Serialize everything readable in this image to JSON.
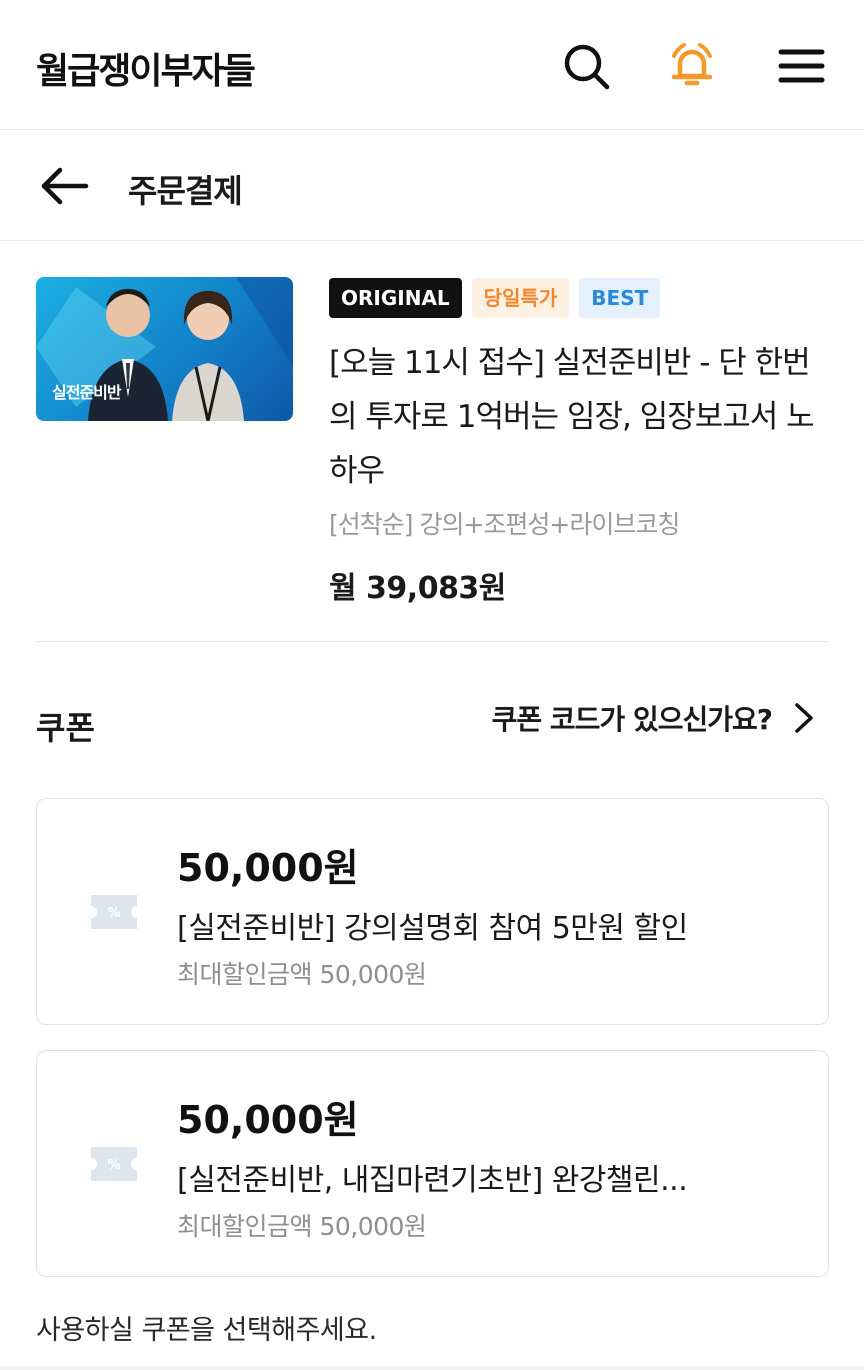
{
  "header": {
    "logo": "월급쟁이부자들",
    "icons": {
      "search": "search-icon",
      "notification": "bell-icon",
      "menu": "hamburger-menu-icon"
    },
    "accent_color": "#f39a2b"
  },
  "subheader": {
    "back_icon": "arrow-left-icon",
    "title": "주문결제"
  },
  "product": {
    "thumbnail_label": "실전준비반",
    "tags": [
      "ORIGINAL",
      "당일특가",
      "BEST"
    ],
    "title": "[오늘 11시 접수] 실전준비반 - 단 한번의 투자로 1억버는 임장, 임장보고서 노하우",
    "option": "[선착순] 강의+조편성+라이브코칭",
    "price": "월 39,083원"
  },
  "coupon": {
    "heading": "쿠폰",
    "code_link": "쿠폰 코드가 있으신가요?",
    "items": [
      {
        "amount": "50,000원",
        "name": "[실전준비반] 강의설명회 참여 5만원 할인",
        "max": "최대할인금액 50,000원"
      },
      {
        "amount": "50,000원",
        "name": "[실전준비반, 내집마련기초반] 완강챌린...",
        "max": "최대할인금액 50,000원"
      }
    ],
    "hint": "사용하실 쿠폰을 선택해주세요."
  }
}
